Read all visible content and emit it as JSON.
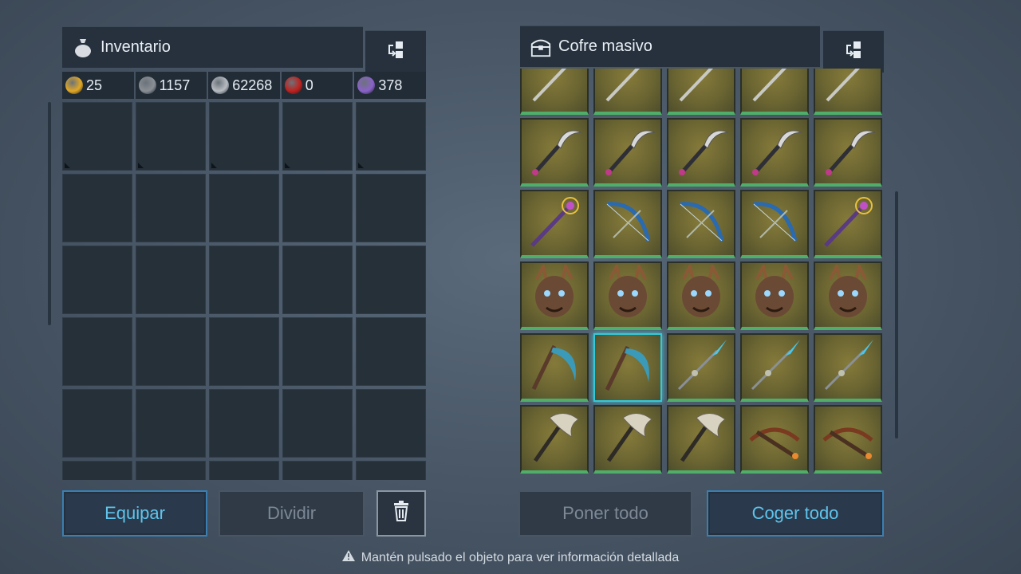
{
  "inventory": {
    "title": "Inventario",
    "currencies": [
      {
        "icon": "gold-coin-icon",
        "color": "#e2a824",
        "value": "25"
      },
      {
        "icon": "rune-token-icon",
        "color": "#8a8f96",
        "value": "1157"
      },
      {
        "icon": "crown-coin-icon",
        "color": "#b7bcc2",
        "value": "62268"
      },
      {
        "icon": "red-emblem-icon",
        "color": "#c0201c",
        "value": "0"
      },
      {
        "icon": "purple-crystal-icon",
        "color": "#8a62c8",
        "value": "378"
      }
    ],
    "slot_count": 30
  },
  "chest": {
    "title": "Cofre masivo",
    "items": [
      "staff",
      "staff",
      "staff",
      "staff",
      "staff",
      "scythe",
      "scythe",
      "scythe",
      "scythe",
      "scythe",
      "purple-staff",
      "bow",
      "bow",
      "bow",
      "purple-staff",
      "dragon-mask",
      "dragon-mask",
      "dragon-mask",
      "dragon-mask",
      "dragon-mask",
      "blue-scythe",
      "blue-scythe",
      "spear",
      "spear",
      "spear",
      "axe",
      "axe",
      "axe",
      "crossbow",
      "crossbow"
    ],
    "selected_index": 21
  },
  "buttons": {
    "equip": "Equipar",
    "split": "Dividir",
    "put_all": "Poner todo",
    "take_all": "Coger todo"
  },
  "hint": "Mantén pulsado el objeto para ver información detallada",
  "colors": {
    "accent": "#5fc4ec",
    "rarity_bar": "#4fae6a",
    "item_bg": "#6b6532"
  }
}
